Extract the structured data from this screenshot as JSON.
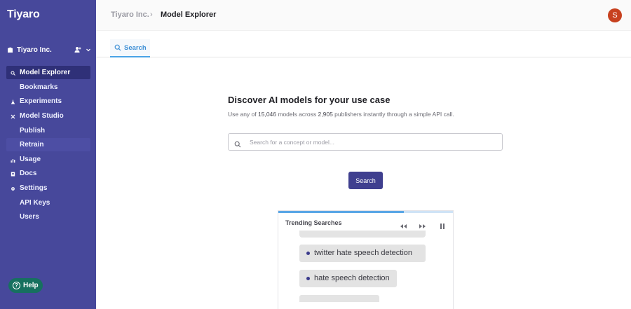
{
  "sidebar": {
    "logo": "Tiyaro",
    "org_name": "Tiyaro Inc.",
    "items": [
      {
        "label": "Model Explorer",
        "icon": "search-icon",
        "active": true
      },
      {
        "label": "Bookmarks",
        "icon": ""
      },
      {
        "label": "Experiments",
        "icon": "flask-icon"
      },
      {
        "label": "Model Studio",
        "icon": "tools-icon"
      },
      {
        "label": "Publish",
        "icon": ""
      },
      {
        "label": "Retrain",
        "icon": ""
      },
      {
        "label": "Usage",
        "icon": "bar-chart-icon"
      },
      {
        "label": "Docs",
        "icon": "document-icon"
      },
      {
        "label": "Settings",
        "icon": "gear-icon"
      },
      {
        "label": "API Keys",
        "icon": ""
      },
      {
        "label": "Users",
        "icon": ""
      }
    ],
    "help_label": "Help"
  },
  "header": {
    "breadcrumb_org": "Tiyaro Inc.",
    "breadcrumb_sep": "›",
    "breadcrumb_page": "Model Explorer",
    "avatar_initial": "S",
    "avatar_color": "#c7411f"
  },
  "tabs": [
    {
      "label": "Search",
      "icon": "search-icon"
    }
  ],
  "main": {
    "title": "Discover AI models for your use case",
    "subtitle_pre": "Use any of ",
    "model_count": "15,046",
    "subtitle_mid": " models across ",
    "publisher_count": "2,905",
    "subtitle_post": " publishers instantly through a simple API call.",
    "search_placeholder": "Search for a concept or model...",
    "search_button": "Search"
  },
  "trending": {
    "title": "Trending Searches",
    "progress": 0.72,
    "items": [
      "twitter hate speech detection",
      "hate speech detection"
    ]
  },
  "colors": {
    "sidebar_bg": "#47489b",
    "accent": "#3f3f8f",
    "tab_accent": "#4aa3e6",
    "help_bg": "#16705f"
  }
}
